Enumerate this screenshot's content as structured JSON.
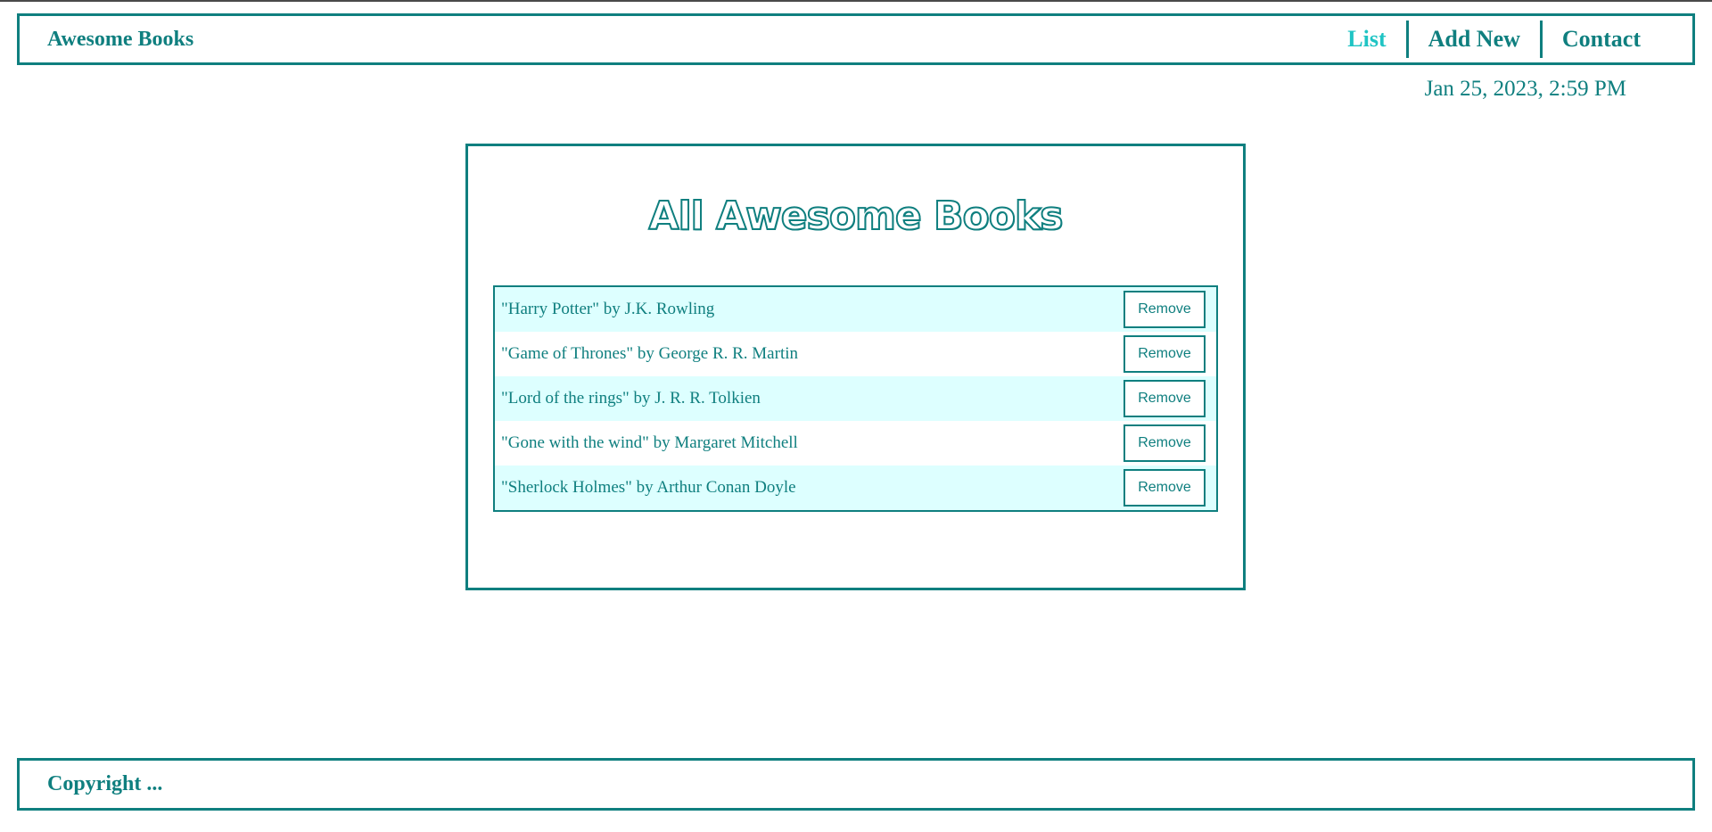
{
  "header": {
    "brand": "Awesome Books",
    "nav": [
      {
        "label": "List"
      },
      {
        "label": "Add New"
      },
      {
        "label": "Contact"
      }
    ],
    "active_nav": "List"
  },
  "datetime": "Jan 25, 2023, 2:59 PM",
  "main": {
    "title": "All Awesome Books",
    "books": [
      {
        "text": "\"Harry Potter\" by J.K. Rowling",
        "button": "Remove"
      },
      {
        "text": "\"Game of Thrones\" by George R. R. Martin",
        "button": "Remove"
      },
      {
        "text": "\"Lord of the rings\" by J. R. R. Tolkien",
        "button": "Remove"
      },
      {
        "text": "\"Gone with the wind\" by Margaret Mitchell",
        "button": "Remove"
      },
      {
        "text": "\"Sherlock Holmes\" by Arthur Conan Doyle",
        "button": "Remove"
      }
    ]
  },
  "footer": {
    "text": "Copyright ..."
  },
  "colors": {
    "primary": "#0f7f7f",
    "active_link": "#1fc4c4",
    "row_alt": "#ddffff"
  }
}
